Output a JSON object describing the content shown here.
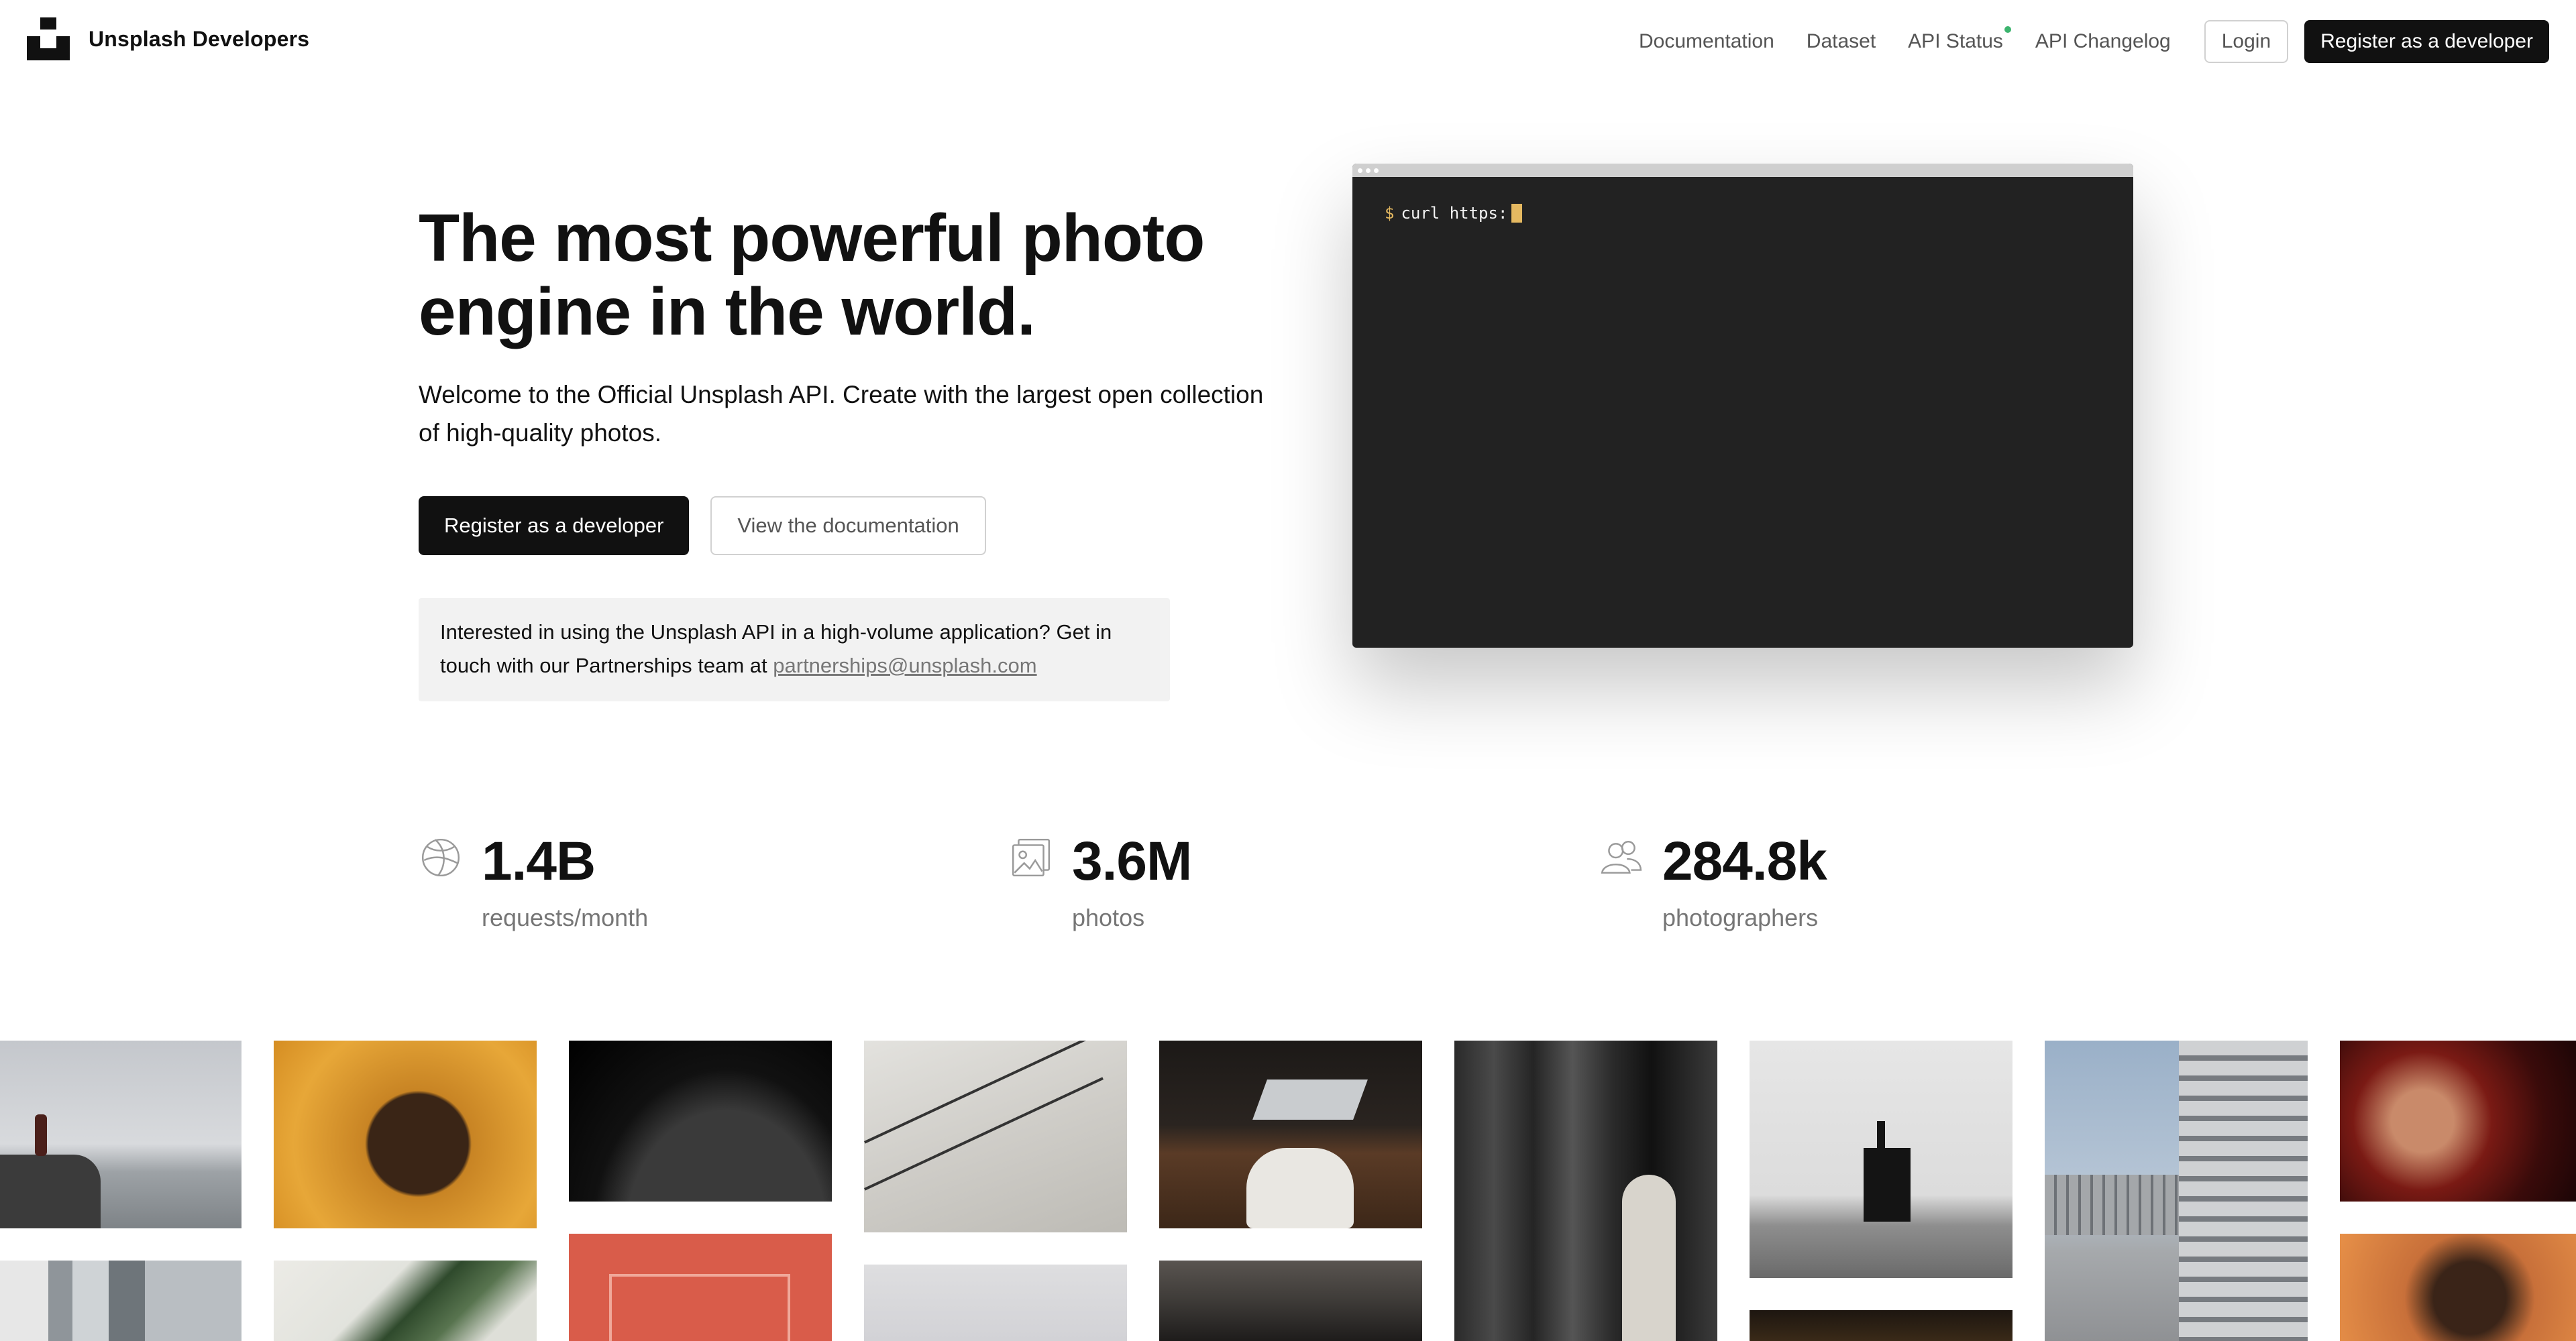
{
  "header": {
    "brand": "Unsplash Developers",
    "nav": {
      "documentation": "Documentation",
      "dataset": "Dataset",
      "api_status": "API Status",
      "api_changelog": "API Changelog",
      "login": "Login",
      "register": "Register as a developer"
    }
  },
  "hero": {
    "title": "The most powerful photo engine in the world.",
    "subtitle": "Welcome to the Official Unsplash API. Create with the largest open collection of high-quality photos.",
    "primary_button": "Register as a developer",
    "secondary_button": "View the documentation",
    "partnership_text": "Interested in using the Unsplash API in a high-volume application? Get in touch with our Partnerships team at",
    "partnership_email": "partnerships@unsplash.com"
  },
  "terminal": {
    "prompt": "$",
    "command": "curl https:"
  },
  "stats": [
    {
      "value": "1.4B",
      "label": "requests/month",
      "icon": "globe-icon"
    },
    {
      "value": "3.6M",
      "label": "photos",
      "icon": "image-icon"
    },
    {
      "value": "284.8k",
      "label": "photographers",
      "icon": "people-icon"
    }
  ],
  "colors": {
    "primary": "#111111",
    "status_ok": "#3cb46e",
    "terminal_bg": "#222222",
    "terminal_accent": "#e5b961",
    "muted_text": "#767676",
    "info_box_bg": "#f2f2f2"
  }
}
